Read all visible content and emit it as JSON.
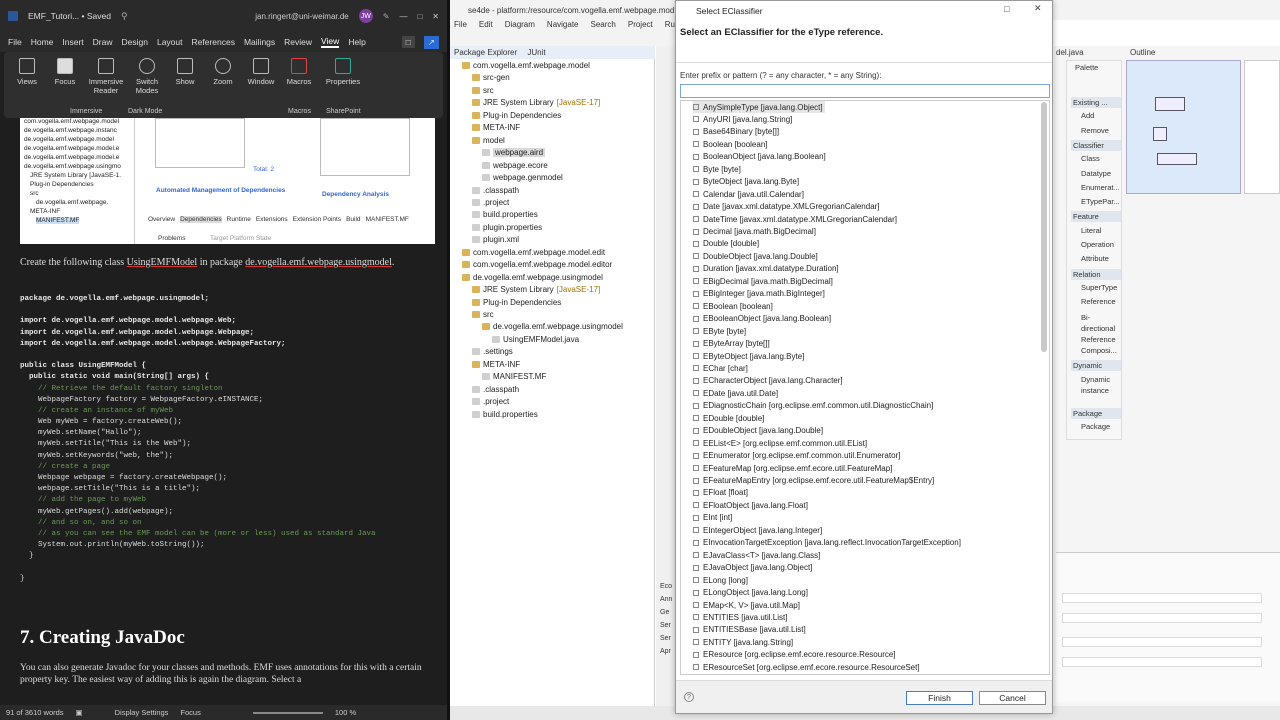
{
  "word": {
    "title": "EMF_Tutori... • Saved",
    "user": "jan.ringert@uni-weimar.de",
    "avatar": "JW",
    "tabs": [
      "File",
      "Home",
      "Insert",
      "Draw",
      "Design",
      "Layout",
      "References",
      "Mailings",
      "Review",
      "View",
      "Help"
    ],
    "ribbon": [
      {
        "label": "Views"
      },
      {
        "label": "Focus"
      },
      {
        "label": "Immersive Reader"
      },
      {
        "label": "Switch Modes"
      },
      {
        "label": "Show"
      },
      {
        "label": "Zoom"
      },
      {
        "label": "Window"
      },
      {
        "label": "Macros"
      },
      {
        "label": "Properties"
      }
    ],
    "groups": [
      "Immersive",
      "Dark Mode",
      "Macros",
      "SharePoint"
    ],
    "screenshot": {
      "tree": [
        "com.vogella.emf.webpage.model",
        "de.vogella.emf.webpage.instanc",
        "de.vogella.emf.webpage.model",
        "de.vogella.emf.webpage.model.e",
        "de.vogella.emf.webpage.model.e",
        "de.vogella.emf.webpage.usingmo",
        "JRE System Library [JavaSE-1.",
        "Plug-in Dependencies",
        "src",
        "de.vogella.emf.webpage.",
        "META-INF",
        "MANIFEST.MF"
      ],
      "total": "Total: 2",
      "automgmt": "Automated Management of Dependencies",
      "depanalysis": "Dependency Analysis",
      "tabs": [
        "Overview",
        "Dependencies",
        "Runtime",
        "Extensions",
        "Extension Points",
        "Build",
        "MANIFEST.MF"
      ],
      "problems": "Problems",
      "target": "Target Platform State"
    },
    "para1_a": "Create the following class ",
    "para1_b": "UsingEMFModel",
    "para1_c": " in package ",
    "para1_d": "de.vogella.emf.webpage.usingmodel",
    "para1_e": ".",
    "code": [
      "package de.vogella.emf.webpage.usingmodel;",
      "",
      "import de.vogella.emf.webpage.model.webpage.Web;",
      "import de.vogella.emf.webpage.model.webpage.Webpage;",
      "import de.vogella.emf.webpage.model.webpage.WebpageFactory;",
      "",
      "public class UsingEMFModel {",
      "  public static void main(String[] args) {",
      "    // Retrieve the default factory singleton",
      "    WebpageFactory factory = WebpageFactory.eINSTANCE;",
      "    // create an instance of myWeb",
      "    Web myWeb = factory.createWeb();",
      "    myWeb.setName(\"Hallo\");",
      "    myWeb.setTitle(\"This is the Web\");",
      "    myWeb.setKeywords(\"web, the\");",
      "    // create a page",
      "    Webpage webpage = factory.createWebpage();",
      "    webpage.setTitle(\"This is a title\");",
      "    // add the page to myWeb",
      "    myWeb.getPages().add(webpage);",
      "    // and so on, and so on",
      "    // as you can see the EMF model can be (more or less) used as standard Java",
      "    System.out.println(myWeb.toString());",
      "  }",
      "",
      "}"
    ],
    "heading": "7. Creating JavaDoc",
    "para2": "You can also generate Javadoc for your classes and methods. EMF uses annotations for this with a certain property key. The easiest way of adding this is again the diagram. Select a",
    "status": {
      "words": "91 of 3610 words",
      "display": "Display Settings",
      "focus": "Focus",
      "zoom": "100 %"
    }
  },
  "eclipse": {
    "title": "se4de - platform:/resource/com.vogella.emf.webpage.mod",
    "menu": [
      "File",
      "Edit",
      "Diagram",
      "Navigate",
      "Search",
      "Project",
      "Run"
    ],
    "package_explorer": "Package Explorer",
    "junit": "JUnit",
    "tree": [
      {
        "label": "com.vogella.emf.webpage.model",
        "indent": 0
      },
      {
        "label": "src-gen",
        "indent": 1
      },
      {
        "label": "src",
        "indent": 1
      },
      {
        "label": "JRE System Library",
        "extra": "[JavaSE-17]",
        "indent": 1
      },
      {
        "label": "Plug-in Dependencies",
        "indent": 1
      },
      {
        "label": "META-INF",
        "indent": 1
      },
      {
        "label": "model",
        "indent": 1
      },
      {
        "label": "webpage.aird",
        "indent": 2
      },
      {
        "label": "webpage.ecore",
        "indent": 2
      },
      {
        "label": "webpage.genmodel",
        "indent": 2
      },
      {
        "label": ".classpath",
        "indent": 1
      },
      {
        "label": ".project",
        "indent": 1
      },
      {
        "label": "build.properties",
        "indent": 1
      },
      {
        "label": "plugin.properties",
        "indent": 1
      },
      {
        "label": "plugin.xml",
        "indent": 1
      },
      {
        "label": "com.vogella.emf.webpage.model.edit",
        "indent": 0
      },
      {
        "label": "com.vogella.emf.webpage.model.editor",
        "indent": 0
      },
      {
        "label": "de.vogella.emf.webpage.usingmodel",
        "indent": 0
      },
      {
        "label": "JRE System Library",
        "extra": "[JavaSE-17]",
        "indent": 1
      },
      {
        "label": "Plug-in Dependencies",
        "indent": 1
      },
      {
        "label": "src",
        "indent": 1
      },
      {
        "label": "de.vogella.emf.webpage.usingmodel",
        "indent": 2
      },
      {
        "label": "UsingEMFModel.java",
        "indent": 3
      },
      {
        "label": ".settings",
        "indent": 1
      },
      {
        "label": "META-INF",
        "indent": 1
      },
      {
        "label": "MANIFEST.MF",
        "indent": 2
      },
      {
        "label": ".classpath",
        "indent": 1
      },
      {
        "label": ".project",
        "indent": 1
      },
      {
        "label": "build.properties",
        "indent": 1
      }
    ],
    "palette": {
      "title": "Palette",
      "items": [
        {
          "label": "Existing ...",
          "head": true
        },
        {
          "label": "Add"
        },
        {
          "label": "Remove"
        },
        {
          "label": "Classifier",
          "head": true
        },
        {
          "label": "Class"
        },
        {
          "label": "Datatype"
        },
        {
          "label": "Enumerat..."
        },
        {
          "label": "ETypePar..."
        },
        {
          "label": "Feature",
          "head": true
        },
        {
          "label": "Literal"
        },
        {
          "label": "Operation"
        },
        {
          "label": "Attribute"
        },
        {
          "label": "Relation",
          "head": true
        },
        {
          "label": "SuperType"
        },
        {
          "label": "Reference"
        },
        {
          "label": "Bi-directional Reference"
        },
        {
          "label": "Composi..."
        },
        {
          "label": "Dynamic",
          "head": true
        },
        {
          "label": "Dynamic instance"
        },
        {
          "label": "Package",
          "head": true
        },
        {
          "label": "Package"
        }
      ]
    },
    "outline": "Outline",
    "editor_tab": "del.java",
    "side_labels": [
      "Eco",
      "Ann",
      "Ge",
      "Ser",
      "Ser",
      "Apr"
    ]
  },
  "dialog": {
    "title": "Select EClassifier",
    "header": "Select an EClassifier for the eType reference.",
    "prompt": "Enter prefix or pattern (? = any character, * = any String):",
    "input_value": "",
    "items": [
      "AnySimpleType [java.lang.Object]",
      "AnyURI [java.lang.String]",
      "Base64Binary [byte[]]",
      "Boolean [boolean]",
      "BooleanObject [java.lang.Boolean]",
      "Byte [byte]",
      "ByteObject [java.lang.Byte]",
      "Calendar [java.util.Calendar]",
      "Date [javax.xml.datatype.XMLGregorianCalendar]",
      "DateTime [javax.xml.datatype.XMLGregorianCalendar]",
      "Decimal [java.math.BigDecimal]",
      "Double [double]",
      "DoubleObject [java.lang.Double]",
      "Duration [javax.xml.datatype.Duration]",
      "EBigDecimal [java.math.BigDecimal]",
      "EBigInteger [java.math.BigInteger]",
      "EBoolean [boolean]",
      "EBooleanObject [java.lang.Boolean]",
      "EByte [byte]",
      "EByteArray [byte[]]",
      "EByteObject [java.lang.Byte]",
      "EChar [char]",
      "ECharacterObject [java.lang.Character]",
      "EDate [java.util.Date]",
      "EDiagnosticChain [org.eclipse.emf.common.util.DiagnosticChain]",
      "EDouble [double]",
      "EDoubleObject [java.lang.Double]",
      "EEList<E> [org.eclipse.emf.common.util.EList]",
      "EEnumerator [org.eclipse.emf.common.util.Enumerator]",
      "EFeatureMap [org.eclipse.emf.ecore.util.FeatureMap]",
      "EFeatureMapEntry [org.eclipse.emf.ecore.util.FeatureMap$Entry]",
      "EFloat [float]",
      "EFloatObject [java.lang.Float]",
      "EInt [int]",
      "EIntegerObject [java.lang.Integer]",
      "EInvocationTargetException [java.lang.reflect.InvocationTargetException]",
      "EJavaClass<T> [java.lang.Class]",
      "EJavaObject [java.lang.Object]",
      "ELong [long]",
      "ELongObject [java.lang.Long]",
      "EMap<K, V> [java.util.Map]",
      "ENTITIES [java.util.List]",
      "ENTITIESBase [java.util.List]",
      "ENTITY [java.lang.String]",
      "EResource [org.eclipse.emf.ecore.resource.Resource]",
      "EResourceSet [org.eclipse.emf.ecore.resource.ResourceSet]"
    ],
    "finish": "Finish",
    "cancel": "Cancel",
    "help": "?"
  }
}
